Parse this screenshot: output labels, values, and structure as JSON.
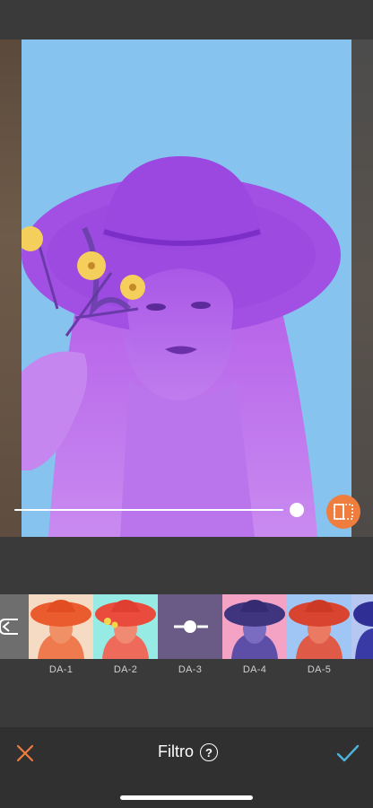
{
  "editor": {
    "tool_title": "Filtro",
    "help_glyph": "?",
    "intensity_value": 1.0,
    "accent_color": "#ef7d3e",
    "confirm_color": "#4cb4dc"
  },
  "filters": [
    {
      "label": "",
      "selected": false,
      "icon": "back-arrow-icon"
    },
    {
      "label": "DA-1",
      "selected": false
    },
    {
      "label": "DA-2",
      "selected": false
    },
    {
      "label": "DA-3",
      "selected": true,
      "icon": "adjust-slider-icon"
    },
    {
      "label": "DA-4",
      "selected": false
    },
    {
      "label": "DA-5",
      "selected": false
    },
    {
      "label": "",
      "selected": false
    }
  ],
  "actions": {
    "cancel_icon": "close-icon",
    "confirm_icon": "check-icon",
    "compare_icon": "compare-icon"
  }
}
